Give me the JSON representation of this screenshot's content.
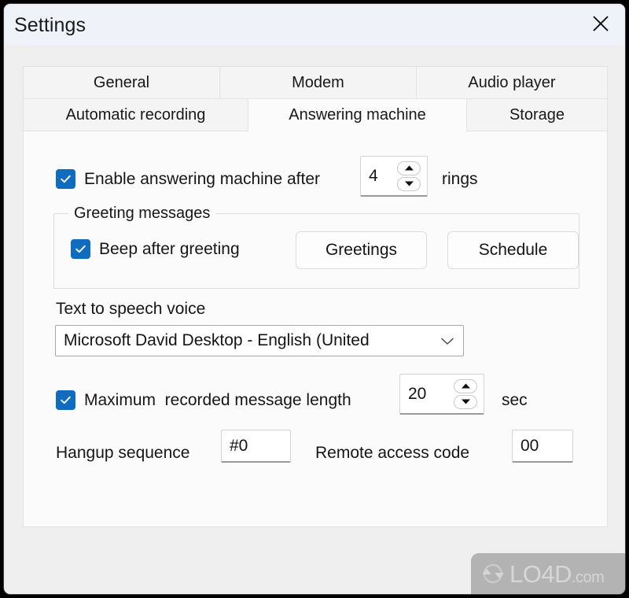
{
  "window": {
    "title": "Settings",
    "close_icon": "close-icon",
    "accent_color": "#0f6cbf",
    "titlebar_color": "#eff2f8",
    "background_color": "#efefef"
  },
  "tabs": {
    "row1": [
      {
        "label": "General",
        "selected": false
      },
      {
        "label": "Modem",
        "selected": false
      },
      {
        "label": "Audio player",
        "selected": false
      }
    ],
    "row2": [
      {
        "label": "Automatic recording",
        "selected": false
      },
      {
        "label": "Answering machine",
        "selected": true
      },
      {
        "label": "Storage",
        "selected": false
      }
    ]
  },
  "panel": {
    "enable_answering": {
      "checked": true,
      "label": "Enable answering machine after",
      "rings_value": "4",
      "rings_suffix": "rings"
    },
    "greeting_group": {
      "legend": "Greeting messages",
      "beep": {
        "checked": true,
        "label": "Beep after greeting"
      },
      "greetings_button": "Greetings",
      "schedule_button": "Schedule"
    },
    "tts": {
      "label": "Text to speech voice",
      "selected_voice": "Microsoft David Desktop - English (United",
      "arrow_icon": "chevron-down-icon"
    },
    "max_length": {
      "checked": true,
      "label": "Maximum  recorded message length",
      "value": "20",
      "suffix": "sec"
    },
    "hangup": {
      "label": "Hangup sequence",
      "value": "#0"
    },
    "remote": {
      "label": "Remote access code",
      "value": "00"
    }
  },
  "watermark": {
    "name": "LO4D",
    "suffix": ".com",
    "logo_icon": "refresh-circle-icon"
  }
}
